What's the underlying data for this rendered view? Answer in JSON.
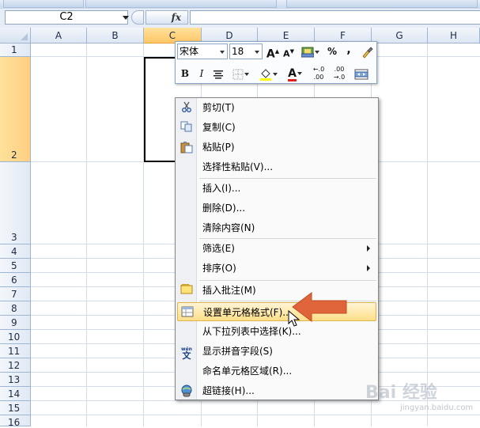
{
  "ribbon": {
    "groups": [
      "",
      "",
      "",
      ""
    ]
  },
  "formula_bar": {
    "name_box": "C2",
    "fx": "fx",
    "content": ""
  },
  "sheet": {
    "columns": [
      "A",
      "B",
      "C",
      "D",
      "E",
      "F",
      "G",
      "H"
    ],
    "rows": [
      "1",
      "2",
      "3",
      "4",
      "5",
      "6",
      "7",
      "8",
      "9",
      "10",
      "11",
      "12",
      "13",
      "14",
      "15",
      "16"
    ],
    "selected_cell": "C2"
  },
  "mini_toolbar": {
    "font": "宋体",
    "size": "18",
    "grow_font": "A",
    "shrink_font": "A",
    "percent": "%",
    "comma": ",",
    "bold": "B",
    "italic": "I",
    "font_color": "A",
    "inc_decimal": ".0",
    "dec_decimal": ".00",
    "colors": {
      "highlight": "#ffff00",
      "font": "#e0201c"
    }
  },
  "context_menu": {
    "items": [
      {
        "label": "剪切(T)",
        "icon": "scissors-icon"
      },
      {
        "label": "复制(C)",
        "icon": "copy-icon"
      },
      {
        "label": "粘贴(P)",
        "icon": "paste-icon"
      },
      {
        "label": "选择性粘贴(V)...",
        "icon": ""
      },
      {
        "label": "插入(I)...",
        "icon": ""
      },
      {
        "label": "删除(D)...",
        "icon": ""
      },
      {
        "label": "清除内容(N)",
        "icon": ""
      },
      {
        "label": "筛选(E)",
        "icon": "",
        "submenu": true
      },
      {
        "label": "排序(O)",
        "icon": "",
        "submenu": true
      },
      {
        "label": "插入批注(M)",
        "icon": "comment-icon"
      },
      {
        "label": "设置单元格格式(F)...",
        "icon": "format-cells-icon",
        "highlighted": true
      },
      {
        "label": "从下拉列表中选择(K)...",
        "icon": ""
      },
      {
        "label": "显示拼音字段(S)",
        "icon": "phonetic-icon"
      },
      {
        "label": "命名单元格区域(R)...",
        "icon": ""
      },
      {
        "label": "超链接(H)...",
        "icon": "hyperlink-icon"
      }
    ]
  },
  "watermark": {
    "text": "Bai 经验",
    "sub": "jingyan.baidu.com"
  },
  "colors": {
    "accent_arrow": "#e0643a",
    "selection": "#ffc768"
  }
}
